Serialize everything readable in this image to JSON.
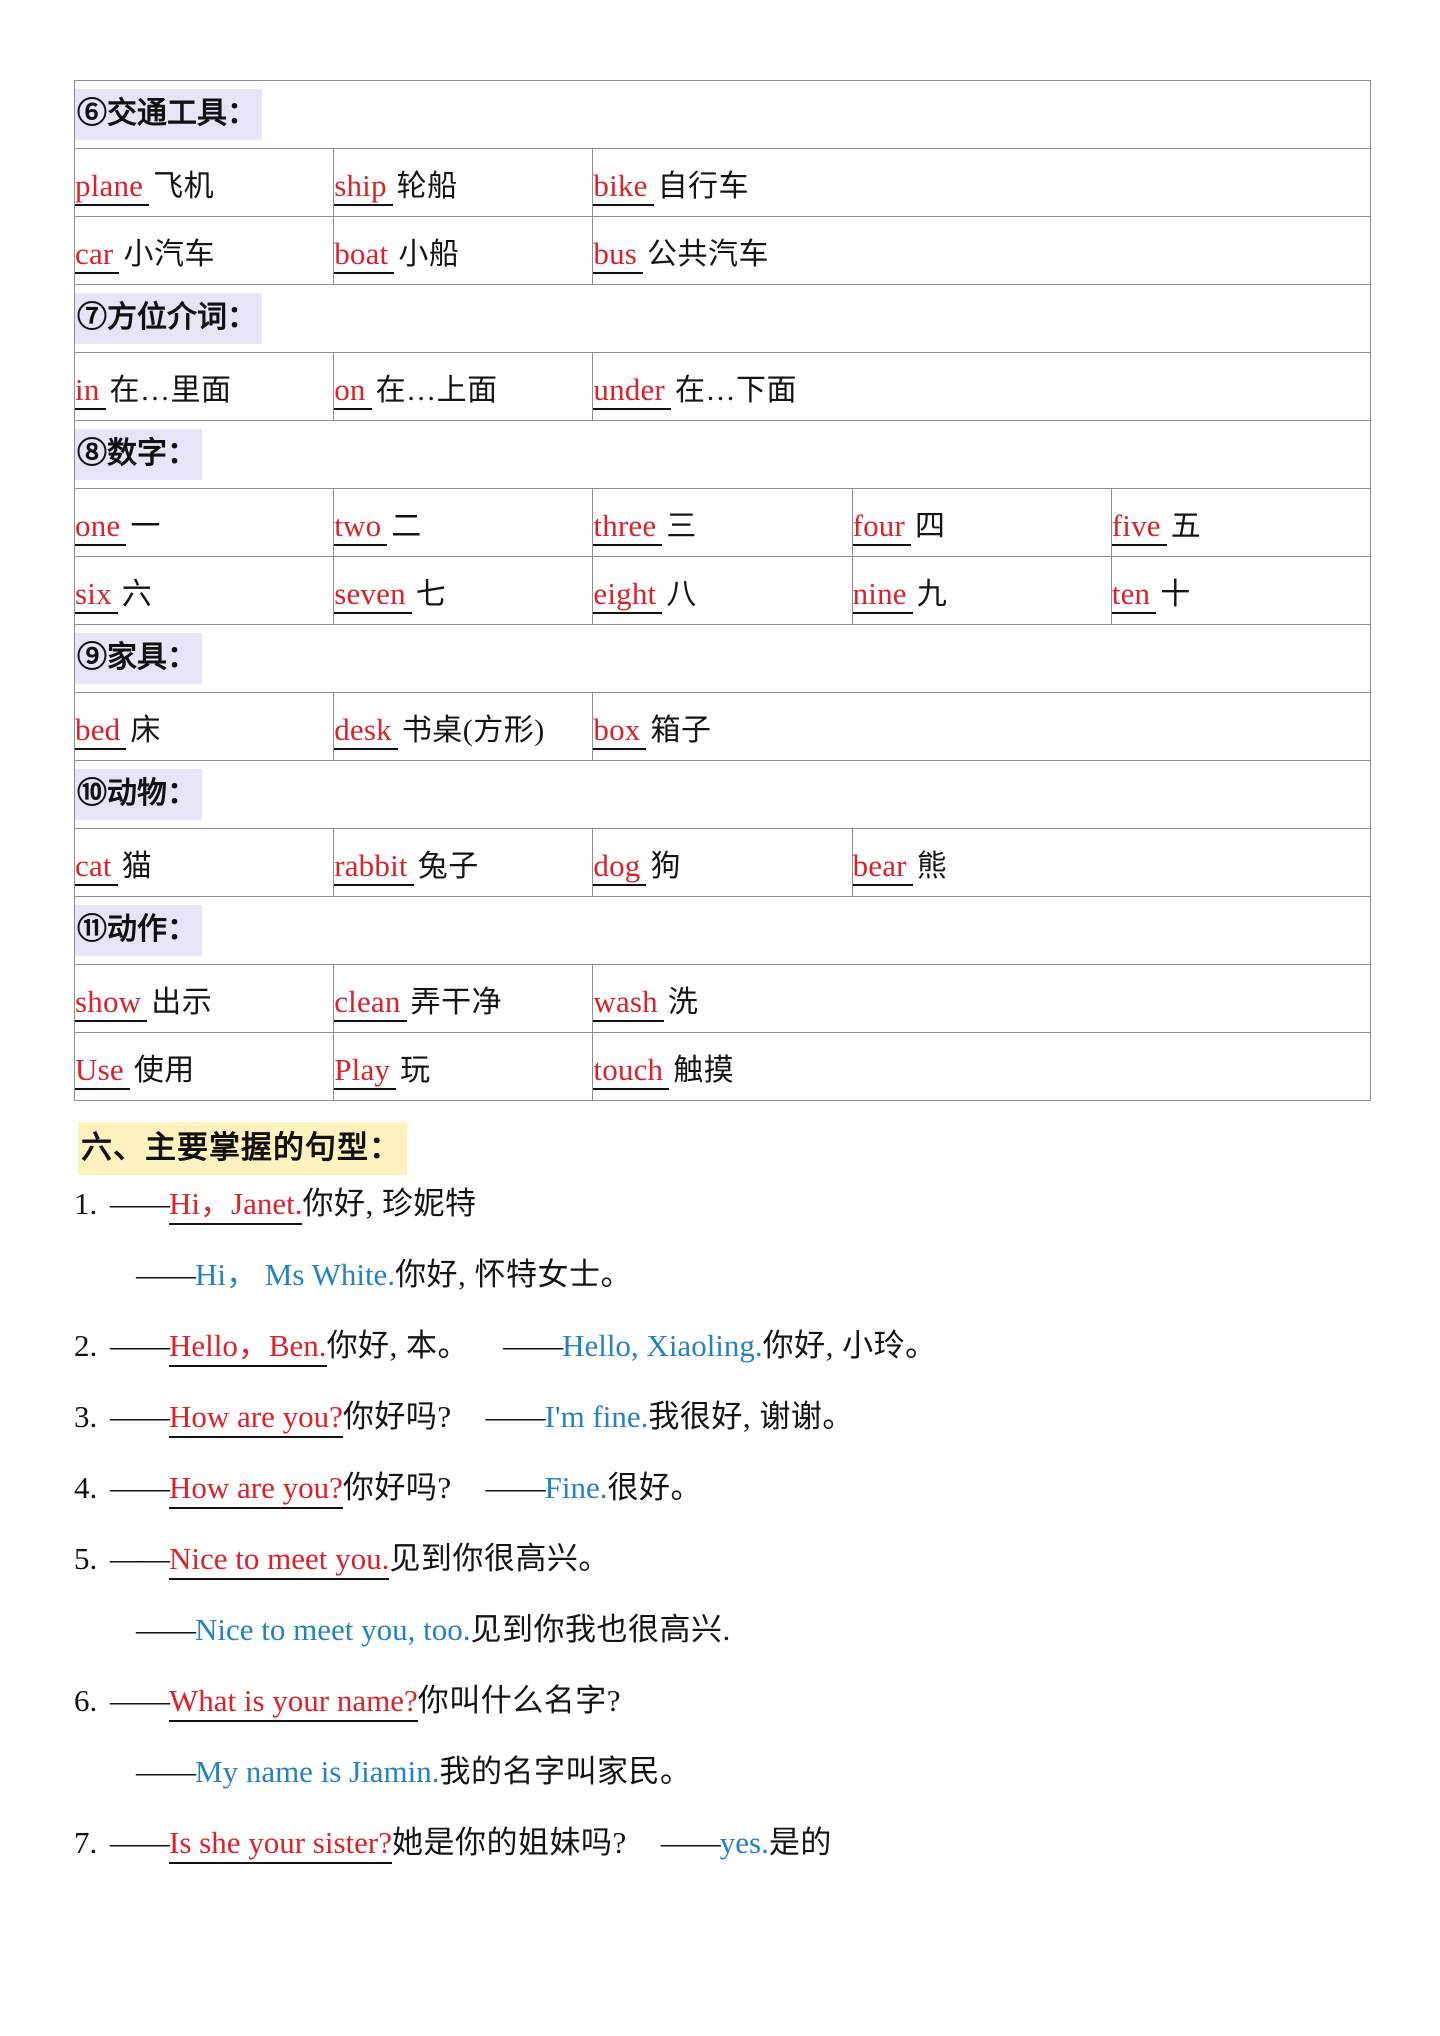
{
  "document": {
    "vocab_sections": [
      {
        "heading": "⑥交通工具：",
        "columns": 3,
        "col_widths": [
          "26%",
          "26%",
          "48%"
        ],
        "rows": [
          [
            {
              "en": "plane",
              "zh": "飞机"
            },
            {
              "en": "ship",
              "zh": "轮船"
            },
            {
              "en": "bike",
              "zh": "自行车"
            }
          ],
          [
            {
              "en": "car",
              "zh": "小汽车"
            },
            {
              "en": "boat",
              "zh": "小船"
            },
            {
              "en": "bus",
              "zh": "公共汽车"
            }
          ]
        ]
      },
      {
        "heading": "⑦方位介词：",
        "columns": 3,
        "col_widths": [
          "26%",
          "26%",
          "48%"
        ],
        "rows": [
          [
            {
              "en": "in",
              "zh": "在…里面"
            },
            {
              "en": "on",
              "zh": "在…上面"
            },
            {
              "en": "under",
              "zh": "在…下面"
            }
          ]
        ]
      },
      {
        "heading": "⑧数字：",
        "columns": 5,
        "col_widths": [
          "16%",
          "15.5%",
          "15.5%",
          "15.5%",
          "37.5%"
        ],
        "rows": [
          [
            {
              "en": "one",
              "zh": "一"
            },
            {
              "en": "two",
              "zh": "二"
            },
            {
              "en": "three",
              "zh": "三"
            },
            {
              "en": "four",
              "zh": "四"
            },
            {
              "en": "five",
              "zh": "五"
            }
          ],
          [
            {
              "en": "six",
              "zh": "六"
            },
            {
              "en": "seven",
              "zh": "七"
            },
            {
              "en": "eight",
              "zh": "八"
            },
            {
              "en": "nine",
              "zh": "九"
            },
            {
              "en": "ten",
              "zh": "十"
            }
          ]
        ]
      },
      {
        "heading": "⑨家具：",
        "columns": 3,
        "col_widths": [
          "26%",
          "26%",
          "48%"
        ],
        "rows": [
          [
            {
              "en": "bed",
              "zh": "床"
            },
            {
              "en": "desk",
              "zh": "书桌(方形)"
            },
            {
              "en": "box",
              "zh": "箱子"
            }
          ]
        ]
      },
      {
        "heading": "⑩动物：",
        "columns": 4,
        "col_widths": [
          "20%",
          "19%",
          "19%",
          "42%"
        ],
        "rows": [
          [
            {
              "en": "cat",
              "zh": "猫"
            },
            {
              "en": "rabbit",
              "zh": "兔子"
            },
            {
              "en": "dog",
              "zh": "狗"
            },
            {
              "en": "bear",
              "zh": "熊"
            }
          ]
        ]
      },
      {
        "heading": "⑪动作：",
        "columns": 3,
        "col_widths": [
          "26%",
          "26%",
          "48%"
        ],
        "rows": [
          [
            {
              "en": "show",
              "zh": "出示"
            },
            {
              "en": "clean",
              "zh": "弄干净"
            },
            {
              "en": "wash",
              "zh": "洗"
            }
          ],
          [
            {
              "en": "Use",
              "zh": "使用"
            },
            {
              "en": "Play",
              "zh": "玩"
            },
            {
              "en": "touch",
              "zh": "触摸"
            }
          ]
        ]
      }
    ],
    "section_heading": "六、主要掌握的句型：",
    "sentences": [
      {
        "num": "1.",
        "lines": [
          {
            "indent": false,
            "parts": [
              {
                "type": "dash",
                "text": "——"
              },
              {
                "type": "q",
                "text": "Hi，Janet."
              },
              {
                "type": "cn",
                "text": "你好, 珍妮特"
              }
            ]
          },
          {
            "indent": true,
            "parts": [
              {
                "type": "dash",
                "text": "——"
              },
              {
                "type": "a",
                "text": "Hi， Ms White."
              },
              {
                "type": "cn",
                "text": "你好, 怀特女士。"
              }
            ]
          }
        ]
      },
      {
        "num": "2.",
        "lines": [
          {
            "indent": false,
            "parts": [
              {
                "type": "dash",
                "text": "——"
              },
              {
                "type": "q",
                "text": "Hello，Ben."
              },
              {
                "type": "cn",
                "text": "你好, 本。"
              },
              {
                "type": "gap",
                "text": ""
              },
              {
                "type": "dash",
                "text": "——"
              },
              {
                "type": "a",
                "text": "Hello, Xiaoling."
              },
              {
                "type": "cn",
                "text": "你好, 小玲。"
              }
            ]
          }
        ]
      },
      {
        "num": "3.",
        "lines": [
          {
            "indent": false,
            "parts": [
              {
                "type": "dash",
                "text": "——"
              },
              {
                "type": "q",
                "text": "How are you?"
              },
              {
                "type": "cn",
                "text": "你好吗?"
              },
              {
                "type": "gap",
                "text": ""
              },
              {
                "type": "dash",
                "text": "——"
              },
              {
                "type": "a",
                "text": "I'm fine."
              },
              {
                "type": "cn",
                "text": "我很好, 谢谢。"
              }
            ]
          }
        ]
      },
      {
        "num": "4.",
        "lines": [
          {
            "indent": false,
            "parts": [
              {
                "type": "dash",
                "text": "——"
              },
              {
                "type": "q",
                "text": "How are you?"
              },
              {
                "type": "cn",
                "text": "你好吗?"
              },
              {
                "type": "gap",
                "text": ""
              },
              {
                "type": "dash",
                "text": "——"
              },
              {
                "type": "a",
                "text": "Fine."
              },
              {
                "type": "cn",
                "text": "很好。"
              }
            ]
          }
        ]
      },
      {
        "num": "5.",
        "lines": [
          {
            "indent": false,
            "parts": [
              {
                "type": "dash",
                "text": "——"
              },
              {
                "type": "q",
                "text": "Nice to meet you."
              },
              {
                "type": "cn",
                "text": "见到你很高兴。"
              }
            ]
          },
          {
            "indent": true,
            "parts": [
              {
                "type": "dash",
                "text": "——"
              },
              {
                "type": "a",
                "text": "Nice to meet you, too."
              },
              {
                "type": "cn",
                "text": "见到你我也很高兴."
              }
            ]
          }
        ]
      },
      {
        "num": "6.",
        "lines": [
          {
            "indent": false,
            "parts": [
              {
                "type": "dash",
                "text": "——"
              },
              {
                "type": "q",
                "text": "What is your name?"
              },
              {
                "type": "cn",
                "text": "你叫什么名字?"
              }
            ]
          },
          {
            "indent": true,
            "parts": [
              {
                "type": "dash",
                "text": "——"
              },
              {
                "type": "a",
                "text": "My name is Jiamin."
              },
              {
                "type": "cn",
                "text": "我的名字叫家民。"
              }
            ]
          }
        ]
      },
      {
        "num": "7.",
        "lines": [
          {
            "indent": false,
            "parts": [
              {
                "type": "dash",
                "text": "——"
              },
              {
                "type": "q",
                "text": "Is she your sister?"
              },
              {
                "type": "cn",
                "text": "她是你的姐妹吗?"
              },
              {
                "type": "gap",
                "text": ""
              },
              {
                "type": "dash",
                "text": "——"
              },
              {
                "type": "a",
                "text": "yes."
              },
              {
                "type": "cn",
                "text": "是的"
              }
            ]
          }
        ]
      }
    ]
  },
  "colors": {
    "english_word": "#d9222a",
    "question_red": "#e02029",
    "answer_blue": "#2580c4",
    "chinese_black": "#141414",
    "category_highlight": "#e8e4f7",
    "section_highlight": "#fdf2bd",
    "table_border": "#8d8d8d"
  }
}
